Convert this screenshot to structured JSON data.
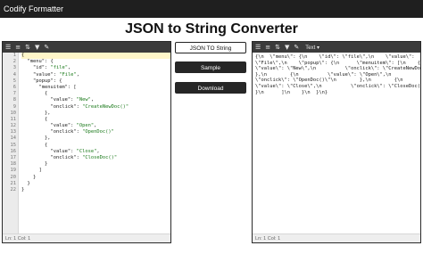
{
  "app": {
    "name": "Codify Formatter"
  },
  "page": {
    "title": "JSON to String Converter"
  },
  "toolbar": {
    "mode_label": "Text ▾"
  },
  "buttons": {
    "json_to_string": "JSON TO String",
    "sample": "Sample",
    "download": "Download"
  },
  "editor": {
    "line_numbers": [
      "1",
      "2",
      "3",
      "4",
      "5",
      "6",
      "7",
      "8",
      "9",
      "10",
      "11",
      "12",
      "13",
      "14",
      "15",
      "16",
      "17",
      "18",
      "19",
      "20",
      "21",
      "22"
    ],
    "lines": [
      "{",
      "  \"menu\": {",
      "    \"id\": \"file\",",
      "    \"value\": \"File\",",
      "    \"popup\": {",
      "      \"menuitem\": [",
      "        {",
      "          \"value\": \"New\",",
      "          \"onclick\": \"CreateNewDoc()\"",
      "        },",
      "        {",
      "          \"value\": \"Open\",",
      "          \"onclick\": \"OpenDoc()\"",
      "        },",
      "        {",
      "          \"value\": \"Close\",",
      "          \"onclick\": \"CloseDoc()\"",
      "        }",
      "      ]",
      "    }",
      "  }",
      "}"
    ],
    "status": "Ln: 1    Col: 1"
  },
  "output": {
    "text": "{\\n  \\\"menu\\\": {\\n    \\\"id\\\": \\\"file\\\",\\n    \\\"value\\\":\n\\\"File\\\",\\n    \\\"popup\\\": {\\n      \\\"menuitem\\\": [\\n    {\\n\n\\\"value\\\": \\\"New\\\",\\n          \\\"onclick\\\": \\\"CreateNewDoc()\\\"\\n\n},\\n        {\\n          \\\"value\\\": \\\"Open\\\",\\n\n\\\"onclick\\\": \\\"OpenDoc()\\\"\\n        },\\n        {\\n\n\\\"value\\\": \\\"Close\\\",\\n          \\\"onclick\\\": \\\"CloseDoc()\\\"\\n\n}\\n      ]\\n    }\\n  }\\n}",
    "status": "Ln: 1    Col: 1"
  },
  "icons": [
    "align-left-icon",
    "list-icon",
    "sort-icon",
    "filter-icon",
    "wrench-icon"
  ]
}
